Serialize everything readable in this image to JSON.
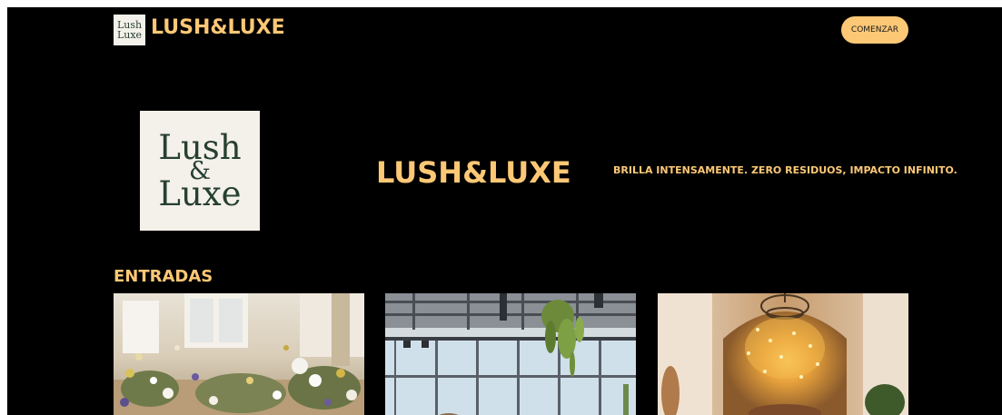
{
  "header": {
    "logo_line1": "Lush",
    "logo_line2": "Luxe",
    "logo_amp": "&",
    "brand_name": "LUSH&LUXE",
    "cta_label": "COMENZAR"
  },
  "hero": {
    "logo_line1": "Lush",
    "logo_amp": "&",
    "logo_line2": "Luxe",
    "title": "LUSH&LUXE",
    "tagline": "BRILLA INTENSAMENTE. ZERO RESIDUOS, IMPACTO INFINITO."
  },
  "entries": {
    "title": "ENTRADAS",
    "cards": [
      {
        "image": "wildflower-table-photo"
      },
      {
        "image": "industrial-loft-hanging-plants-photo"
      },
      {
        "image": "fairy-lights-arch-photo"
      }
    ]
  },
  "colors": {
    "background": "#000000",
    "accent": "#fcc876",
    "logo_bg": "#f4f0ea",
    "logo_text": "#26402f"
  }
}
